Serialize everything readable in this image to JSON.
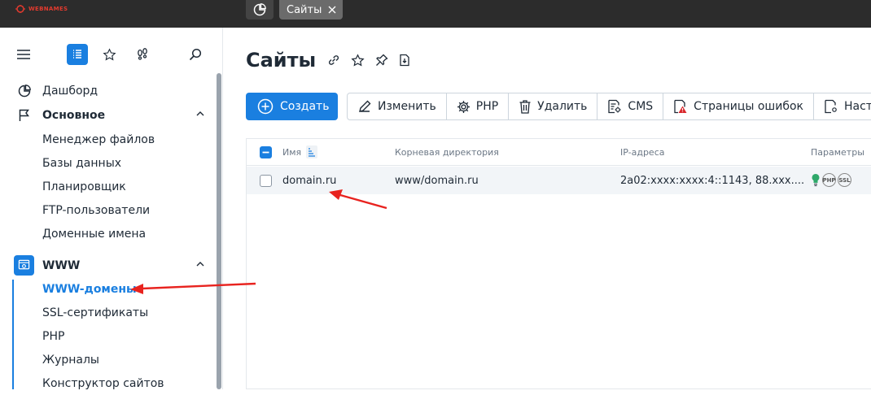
{
  "topbar": {
    "logo_text": "WEBNAMES",
    "active_tab_label": "Сайты"
  },
  "sidebar": {
    "items": [
      {
        "label": "Дашборд"
      },
      {
        "label": "Основное"
      },
      {
        "label": "Менеджер файлов"
      },
      {
        "label": "Базы данных"
      },
      {
        "label": "Планировщик"
      },
      {
        "label": "FTP-пользователи"
      },
      {
        "label": "Доменные имена"
      },
      {
        "label": "WWW"
      },
      {
        "label": "WWW-домены"
      },
      {
        "label": "SSL-сертификаты"
      },
      {
        "label": "PHP"
      },
      {
        "label": "Журналы"
      },
      {
        "label": "Конструктор сайтов"
      }
    ]
  },
  "main": {
    "title": "Сайты",
    "toolbar": {
      "create_label": "Создать",
      "buttons": [
        {
          "label": "Изменить"
        },
        {
          "label": "PHP"
        },
        {
          "label": "Удалить"
        },
        {
          "label": "CMS"
        },
        {
          "label": "Страницы ошибок"
        },
        {
          "label": "Наст"
        }
      ]
    },
    "table": {
      "columns": [
        {
          "label": "Имя"
        },
        {
          "label": "Корневая директория"
        },
        {
          "label": "IP-адреса"
        },
        {
          "label": "Параметры"
        }
      ],
      "rows": [
        {
          "name": "domain.ru",
          "root": "www/domain.ru",
          "ip": "2a02:xxxx:xxxx:4::1143, 88.xxx....",
          "params": [
            "PHP",
            "SSL"
          ]
        }
      ]
    }
  },
  "colors": {
    "accent": "#1a7fe0",
    "arrow": "#e8231f",
    "topbar": "#2c2c2c"
  }
}
